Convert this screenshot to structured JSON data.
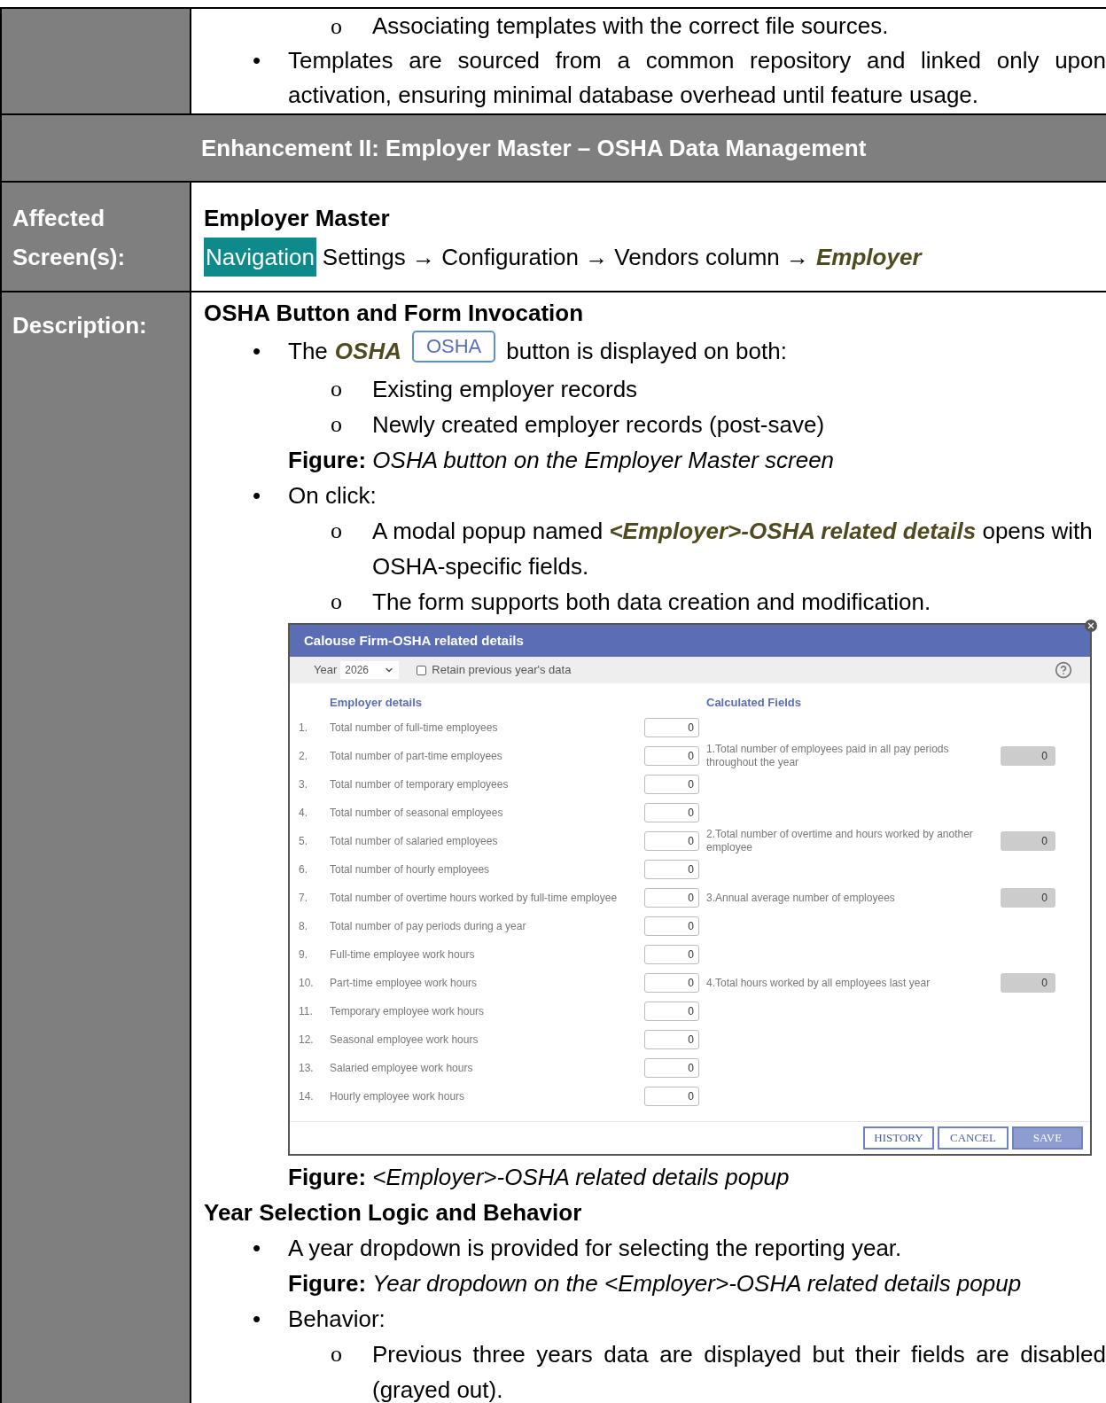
{
  "top_row": {
    "items": [
      {
        "kind": "sub",
        "marker": "o",
        "text": "Associating templates with the correct file sources."
      },
      {
        "kind": "main",
        "marker": "•",
        "text": "Templates are sourced from a common repository and linked only upon activation, ensuring minimal database overhead until feature usage."
      }
    ]
  },
  "section_header": "Enhancement II: Employer Master – OSHA Data Management",
  "affected": {
    "label": "Affected Screen(s):",
    "title": "Employer Master",
    "nav_badge": "Navigation",
    "path": "Settings → Configuration → Vendors column →",
    "path_end": "Employer"
  },
  "description": {
    "label": "Description:",
    "blocks": [
      {
        "kind": "heading",
        "text": "OSHA Button and Form Invocation"
      },
      {
        "kind": "osha_line",
        "marker": "•",
        "before": "The",
        "emphasis": "OSHA",
        "button": "OSHA",
        "after": "button is displayed on both:"
      },
      {
        "kind": "sub",
        "marker": "o",
        "text": "Existing employer records"
      },
      {
        "kind": "sub",
        "marker": "o",
        "text": "Newly created employer records (post-save)"
      },
      {
        "kind": "caption",
        "text": "**Figure:** *OSHA button on the Employer Master screen*"
      },
      {
        "kind": "main",
        "marker": "•",
        "text": "On click:"
      },
      {
        "kind": "modal_line",
        "marker": "o",
        "before": "A modal popup named",
        "emphasis": "<Employer>-OSHA related details",
        "after": "opens with OSHA-specific fields."
      },
      {
        "kind": "sub",
        "marker": "o",
        "text": "The form supports both data creation and modification."
      },
      {
        "kind": "popup",
        "title": "Calouse Firm-OSHA related details",
        "year_label": "Year",
        "year_value": "2026",
        "retain": {
          "label": "Retain previous year's data",
          "checked": false
        },
        "left_heading": "Employer details",
        "right_heading": "Calculated Fields",
        "rows": [
          {
            "number": "1.",
            "label": "Total number of full-time employees",
            "value": "0",
            "disabled": false
          },
          {
            "number": "2.",
            "label": "Total number of part-time employees",
            "value": "0",
            "disabled": false,
            "calculated": {
              "label": "1.Total number of employees paid in all pay periods throughout the year",
              "value": "0",
              "disabled": true
            }
          },
          {
            "number": "3.",
            "label": "Total number of temporary employees",
            "value": "0",
            "disabled": false
          },
          {
            "number": "4.",
            "label": "Total number of seasonal employees",
            "value": "0",
            "disabled": false
          },
          {
            "number": "5.",
            "label": "Total number of salaried employees",
            "value": "0",
            "disabled": false,
            "calculated": {
              "label": "2.Total number of overtime and hours worked by another employee",
              "value": "0",
              "disabled": true
            }
          },
          {
            "number": "6.",
            "label": "Total number of hourly employees",
            "value": "0",
            "disabled": false
          },
          {
            "number": "7.",
            "label": "Total number of overtime hours worked by full-time employee",
            "value": "0",
            "disabled": false,
            "calculated": {
              "label": "3.Annual average number of employees",
              "value": "0",
              "disabled": true
            }
          },
          {
            "number": "8.",
            "label": "Total number of pay periods during a year",
            "value": "0",
            "disabled": false
          },
          {
            "number": "9.",
            "label": "Full-time employee work hours",
            "value": "0",
            "disabled": false
          },
          {
            "number": "10.",
            "label": "Part-time employee work hours",
            "value": "0",
            "disabled": false,
            "calculated": {
              "label": "4.Total hours worked by all employees last year",
              "value": "0",
              "disabled": true
            }
          },
          {
            "number": "11.",
            "label": "Temporary employee work hours",
            "value": "0",
            "disabled": false
          },
          {
            "number": "12.",
            "label": "Seasonal employee work hours",
            "value": "0",
            "disabled": false
          },
          {
            "number": "13.",
            "label": "Salaried employee work hours",
            "value": "0",
            "disabled": false
          },
          {
            "number": "14.",
            "label": "Hourly employee work hours",
            "value": "0",
            "disabled": false
          }
        ],
        "buttons": [
          {
            "label": "HISTORY",
            "disabled": false
          },
          {
            "label": "CANCEL",
            "disabled": false
          },
          {
            "label": "SAVE",
            "disabled": true
          }
        ]
      },
      {
        "kind": "caption",
        "text": "**Figure:** *<Employer>-OSHA related details popup*"
      },
      {
        "kind": "heading",
        "text": "Year Selection Logic and Behavior"
      },
      {
        "kind": "main",
        "marker": "•",
        "text": "A year dropdown is provided for selecting the reporting year."
      },
      {
        "kind": "caption",
        "text": "**Figure:** *Year dropdown on the <Employer>-OSHA related details popup*"
      },
      {
        "kind": "main",
        "marker": "•",
        "text": "Behavior:"
      },
      {
        "kind": "sub",
        "marker": "o",
        "text": "Previous three years data are displayed but their fields are disabled (grayed out)."
      }
    ]
  }
}
